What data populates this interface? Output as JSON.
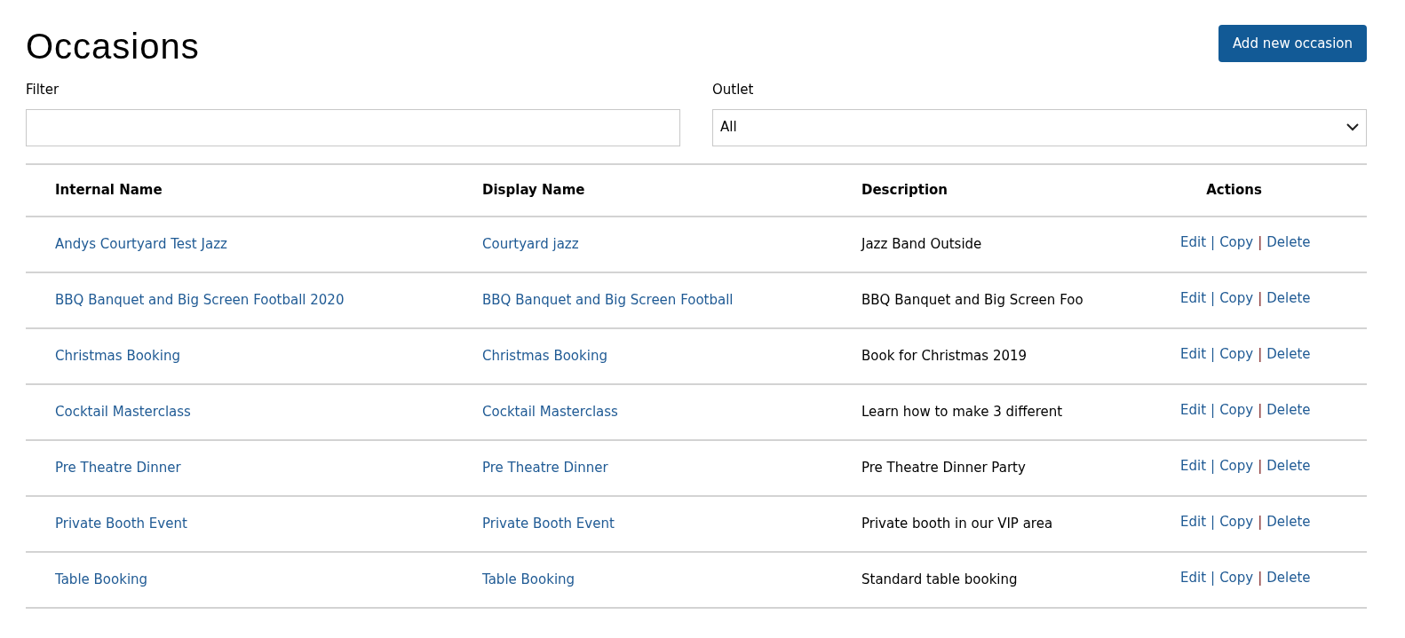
{
  "title": "Occasions",
  "add_button": "Add new occasion",
  "filter": {
    "label": "Filter"
  },
  "outlet": {
    "label": "Outlet",
    "value": "All"
  },
  "table": {
    "columns": [
      "Internal Name",
      "Display Name",
      "Description",
      "Actions"
    ],
    "rows": [
      {
        "internal_name": "Andys Courtyard Test Jazz",
        "display_name": "Courtyard jazz",
        "description": "Jazz Band Outside",
        "actions": [
          "Edit",
          "Copy",
          "Delete"
        ],
        "separators": [
          "|",
          "|"
        ]
      },
      {
        "internal_name": "BBQ Banquet and Big Screen Football 2020",
        "display_name": "BBQ Banquet and Big Screen Football",
        "description": "BBQ Banquet and Big Screen Foo",
        "actions": [
          "Edit",
          "Copy",
          "Delete"
        ],
        "separators": [
          "|",
          "|"
        ]
      },
      {
        "internal_name": "Christmas Booking",
        "display_name": "Christmas Booking",
        "description": "Book for Christmas 2019",
        "actions": [
          "Edit",
          "Copy",
          "Delete"
        ],
        "separators": [
          "|",
          "|"
        ]
      },
      {
        "internal_name": "Cocktail Masterclass",
        "display_name": "Cocktail Masterclass",
        "description": "Learn how to make 3 different",
        "actions": [
          "Edit",
          "Copy",
          "Delete"
        ],
        "separators": [
          "|",
          "|"
        ]
      },
      {
        "internal_name": "Pre Theatre Dinner",
        "display_name": "Pre Theatre Dinner",
        "description": "Pre Theatre Dinner Party",
        "actions": [
          "Edit",
          "Copy",
          "Delete"
        ],
        "separators": [
          "|",
          "|"
        ]
      },
      {
        "internal_name": "Private Booth Event",
        "display_name": "Private Booth Event",
        "description": "Private booth in our VIP area",
        "actions": [
          "Edit",
          "Copy",
          "Delete"
        ],
        "separators": [
          "|",
          "|"
        ]
      },
      {
        "internal_name": "Table Booking",
        "display_name": "Table Booking",
        "description": "Standard table booking",
        "actions": [
          "Edit",
          "Copy",
          "Delete"
        ],
        "separators": [
          "|",
          "|"
        ]
      }
    ]
  }
}
